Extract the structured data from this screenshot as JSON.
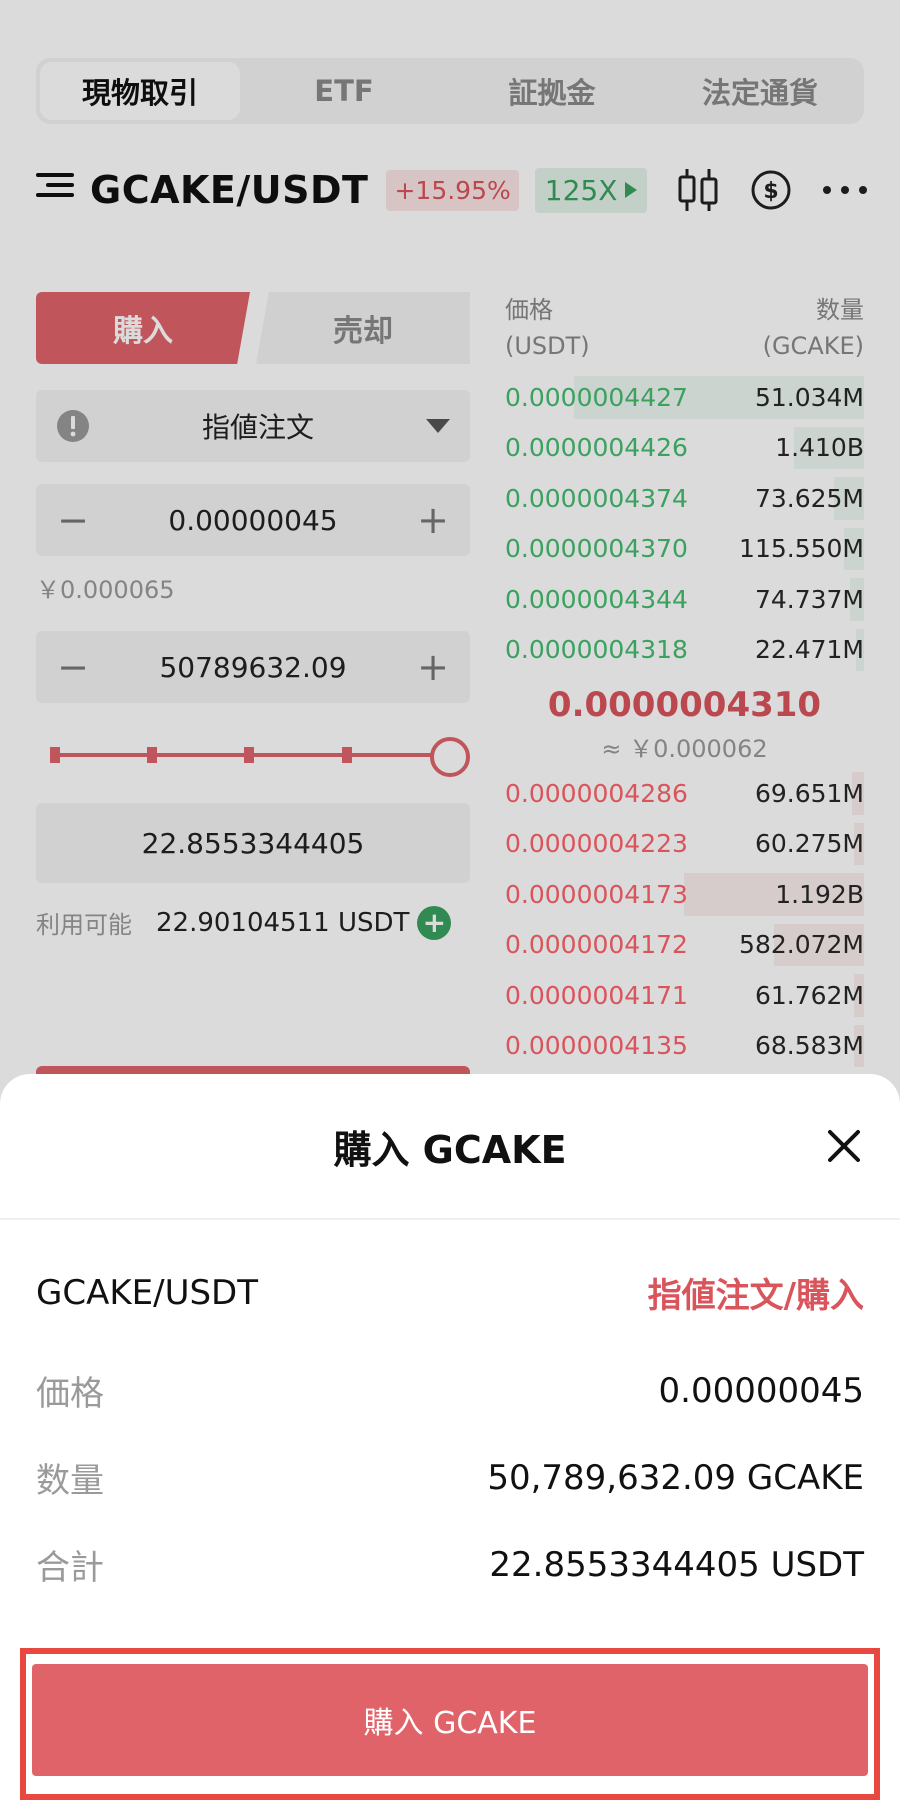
{
  "top_tabs": [
    "現物取引",
    "ETF",
    "証拠金",
    "法定通貨"
  ],
  "header": {
    "pair": "GCAKE/USDT",
    "change": "+15.95%",
    "leverage": "125X"
  },
  "form": {
    "side_buy": "購入",
    "side_sell": "売却",
    "order_type": "指値注文",
    "price": "0.00000045",
    "price_fiat": "￥0.000065",
    "amount": "50789632.09",
    "total": "22.8553344405",
    "available_label": "利用可能",
    "available_value": "22.90104511 USDT",
    "slider_percent": 100
  },
  "orderbook": {
    "price_header": "価格",
    "price_unit": "(USDT)",
    "qty_header": "数量",
    "qty_unit": "(GCAKE)",
    "asks": [
      {
        "price": "0.0000004427",
        "qty": "51.034M"
      },
      {
        "price": "0.0000004426",
        "qty": "1.410B"
      },
      {
        "price": "0.0000004374",
        "qty": "73.625M"
      },
      {
        "price": "0.0000004370",
        "qty": "115.550M"
      },
      {
        "price": "0.0000004344",
        "qty": "74.737M"
      },
      {
        "price": "0.0000004318",
        "qty": "22.471M"
      }
    ],
    "last_price": "0.0000004310",
    "last_price_fiat": "≈ ￥0.000062",
    "bids": [
      {
        "price": "0.0000004286",
        "qty": "69.651M"
      },
      {
        "price": "0.0000004223",
        "qty": "60.275M"
      },
      {
        "price": "0.0000004173",
        "qty": "1.192B"
      },
      {
        "price": "0.0000004172",
        "qty": "582.072M"
      },
      {
        "price": "0.0000004171",
        "qty": "61.762M"
      },
      {
        "price": "0.0000004135",
        "qty": "68.583M"
      }
    ]
  },
  "sheet": {
    "title": "購入 GCAKE",
    "pair": "GCAKE/USDT",
    "order_type": "指値注文/購入",
    "rows": [
      {
        "label": "価格",
        "value": "0.00000045"
      },
      {
        "label": "数量",
        "value": "50,789,632.09 GCAKE"
      },
      {
        "label": "合計",
        "value": "22.8553344405 USDT"
      }
    ],
    "confirm_label": "購入 GCAKE"
  },
  "colors": {
    "buy_red": "#e0636a",
    "ask_green": "#3aa15f",
    "bid_red": "#d9545b",
    "highlight": "#e8483f"
  },
  "icons": [
    "menu-icon",
    "candlestick-icon",
    "dollar-icon",
    "more-icon",
    "alert-icon",
    "caret-down-icon",
    "minus-icon",
    "plus-icon",
    "add-funds-icon",
    "close-icon"
  ]
}
